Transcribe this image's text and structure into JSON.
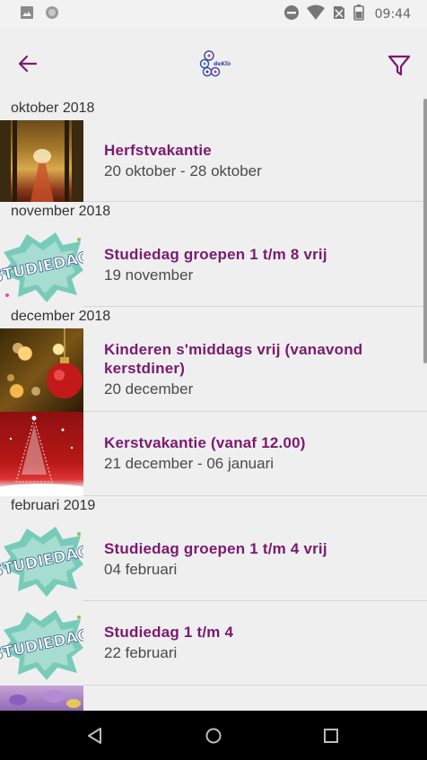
{
  "status_bar": {
    "time": "09:44",
    "left_icons": [
      "image-icon",
      "circle-app-icon"
    ],
    "right_icons": [
      "do-not-disturb-icon",
      "wifi-icon",
      "no-sim-icon",
      "battery-icon"
    ]
  },
  "app_bar": {
    "back_icon": "arrow-left-icon",
    "filter_icon": "filter-icon",
    "logo_text": "deKlim",
    "accent_color": "#7a1a70"
  },
  "sections": [
    {
      "month": "oktober 2018",
      "events": [
        {
          "title": "Herfstvakantie",
          "date": "20 oktober - 28 oktober",
          "thumbnail": "autumn-lane"
        }
      ]
    },
    {
      "month": "november 2018",
      "events": [
        {
          "title": "Studiedag groepen 1 t/m 8 vrij",
          "date": "19 november",
          "thumbnail": "studiedag",
          "thumb_label": "STUDIEDAG"
        }
      ]
    },
    {
      "month": "december 2018",
      "events": [
        {
          "title": "Kinderen s'middags vrij (vanavond kerstdiner)",
          "date": "20 december",
          "thumbnail": "christmas-bauble"
        },
        {
          "title": "Kerstvakantie (vanaf 12.00)",
          "date": "21 december - 06 januari",
          "thumbnail": "christmas-tree"
        }
      ]
    },
    {
      "month": "februari 2019",
      "events": [
        {
          "title": "Studiedag groepen 1 t/m 4 vrij",
          "date": "04 februari",
          "thumbnail": "studiedag",
          "thumb_label": "STUDIEDAG"
        },
        {
          "title": "Studiedag 1 t/m 4",
          "date": "22 februari",
          "thumbnail": "studiedag",
          "thumb_label": "STUDIEDAG"
        },
        {
          "title": "",
          "date": "",
          "thumbnail": "spring-flowers"
        }
      ]
    }
  ],
  "nav_bar": {
    "back": "nav-back-icon",
    "home": "nav-home-icon",
    "recents": "nav-recents-icon"
  }
}
